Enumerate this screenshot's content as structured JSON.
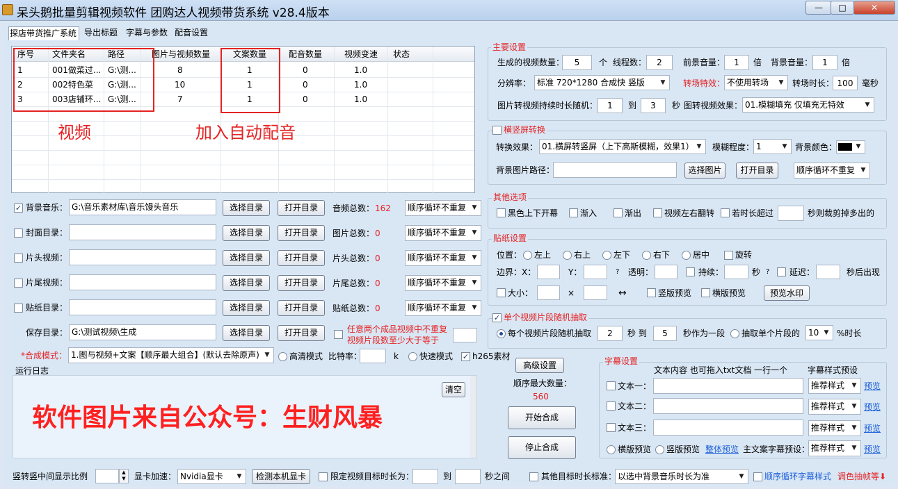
{
  "window": {
    "title": "呆头鹅批量剪辑视频软件    团购达人视频带货系统   v28.4版本",
    "min": "—",
    "max": "□",
    "close": "✕"
  },
  "tabs": [
    "探店带货推广系统",
    "导出标题",
    "字幕与参数",
    "配音设置"
  ],
  "grid": {
    "headers": [
      "序号",
      "文件夹名",
      "路径",
      "图片与视频数量",
      "文案数量",
      "配音数量",
      "视频变速",
      "状态"
    ],
    "rows": [
      [
        "1",
        "001做菜过...",
        "G:\\测...",
        "8",
        "1",
        "0",
        "1.0",
        ""
      ],
      [
        "2",
        "002特色菜",
        "G:\\测...",
        "10",
        "1",
        "0",
        "1.0",
        ""
      ],
      [
        "3",
        "003店铺环...",
        "G:\\测...",
        "7",
        "1",
        "0",
        "1.0",
        ""
      ]
    ],
    "annotation_video": "视频",
    "annotation_voice": "加入自动配音"
  },
  "dirs": [
    {
      "label": "背景音乐：",
      "checked": true,
      "path": "G:\\音乐素材库\\音乐馒头音乐",
      "count_label": "音频总数：",
      "count": "162"
    },
    {
      "label": "封面目录：",
      "checked": false,
      "path": "",
      "count_label": "图片总数：",
      "count": "0"
    },
    {
      "label": "片头视频：",
      "checked": false,
      "path": "",
      "count_label": "片头总数：",
      "count": "0"
    },
    {
      "label": "片尾视频：",
      "checked": false,
      "path": "",
      "count_label": "片尾总数：",
      "count": "0"
    },
    {
      "label": "贴纸目录：",
      "checked": false,
      "path": "",
      "count_label": "贴纸总数：",
      "count": "0"
    }
  ],
  "common": {
    "choose_dir": "选择目录",
    "open_dir": "打开目录",
    "order": "顺序循环不重复"
  },
  "save": {
    "label": "保存目录：",
    "path": "G:\\测试视频\\生成",
    "note1": "任意两个成品视频中不重复",
    "note2": "视频片段数至少大于等于"
  },
  "mode": {
    "label": "*合成模式：",
    "value": "1.图与视频+文案【顺序最大组合】(默认去除原声)",
    "hd": "高清模式",
    "bitrate": "比特率：",
    "k": "k",
    "fast": "快速模式",
    "h265": "h265素材"
  },
  "log": {
    "title": "运行日志",
    "clear": "清空",
    "watermark": "软件图片来自公众号：生财风暴"
  },
  "mid": {
    "advanced": "高级设置",
    "max_label": "顺序最大数量：",
    "max_value": "560",
    "start": "开始合成",
    "stop": "停止合成"
  },
  "main_settings": {
    "title": "主要设置",
    "gen_count_label": "生成的视频数量：",
    "gen_count": "5",
    "unit_ge": "个",
    "threads_label": "线程数：",
    "threads": "2",
    "fg_vol_label": "前景音量：",
    "fg_vol": "1",
    "bei": "倍",
    "bg_vol_label": "背景音量：",
    "bg_vol": "1",
    "res_label": "分辨率：",
    "res": "标准 720*1280 合成快 竖版",
    "trans_label": "转场特效：",
    "trans": "不使用转场",
    "trans_dur_label": "转场时长：",
    "trans_dur": "100",
    "ms": "毫秒",
    "img_dur_label": "图片转视频持续时长随机：",
    "img_min": "1",
    "to": "到",
    "img_max": "3",
    "sec": "秒",
    "img_effect_label": "图转视频效果：",
    "img_effect": "01.模糊填充 仅填充无特效"
  },
  "hv": {
    "title": "横竖屏转换",
    "effect_label": "转换效果：",
    "effect": "01.横屏转竖屏（上下高斯模糊，效果1）",
    "blur_label": "模糊程度：",
    "blur": "1",
    "bgcolor_label": "背景颜色：",
    "bgimg_label": "背景图片路径：",
    "choose_img": "选择图片",
    "open_dir": "打开目录",
    "order": "顺序循环不重复"
  },
  "other": {
    "title": "其他选项",
    "items": [
      "黑色上下开幕",
      "渐入",
      "渐出",
      "视频左右翻转",
      "若时长超过"
    ],
    "tail": "秒则裁剪掉多出的"
  },
  "sticker": {
    "title": "贴纸设置",
    "pos_label": "位置：",
    "positions": [
      "左上",
      "右上",
      "左下",
      "右下",
      "居中"
    ],
    "rotate": "旋转",
    "margin_x": "边界：X：",
    "y": "Y：",
    "opacity": "透明：",
    "duration": "持续：",
    "sec": "秒",
    "delay": "延迟：",
    "appear": "秒后出现",
    "size": "大小：",
    "x": "×",
    "arrows": "↔",
    "vpreview": "竖版预览",
    "hpreview": "横版预览",
    "wm_preview": "预览水印",
    "q": "?"
  },
  "segment": {
    "title": "单个视频片段随机抽取",
    "opt1": "每个视频片段随机抽取",
    "min": "2",
    "sec_to": "秒 到",
    "max": "5",
    "as_one": "秒作为一段",
    "opt2": "抽取单个片段的",
    "pct": "10",
    "pct_label": "%时长"
  },
  "subtitle": {
    "title": "字幕设置",
    "content_hdr": "文本内容 也可拖入txt文档 一行一个",
    "style_hdr": "字幕样式预设",
    "rows": [
      "文本一：",
      "文本二：",
      "文本三："
    ],
    "style": "推荐样式",
    "preview": "预览",
    "hprev": "横版预览",
    "vprev": "竖版预览",
    "whole": "整体预览",
    "main_preset": "主文案字幕预设："
  },
  "bottom": {
    "ratio_label": "竖转竖中间显示比例",
    "gpu_label": "显卡加速：",
    "gpu": "Nvidia显卡",
    "detect": "检测本机显卡",
    "limit": "限定视频目标时长为：",
    "to": "到",
    "between": "秒之间",
    "other_target": "其他目标时长标准：",
    "other_value": "以选中背景音乐时长为准",
    "loop_sub": "顺序循环字幕样式",
    "tune": "调色抽帧等⬇"
  }
}
